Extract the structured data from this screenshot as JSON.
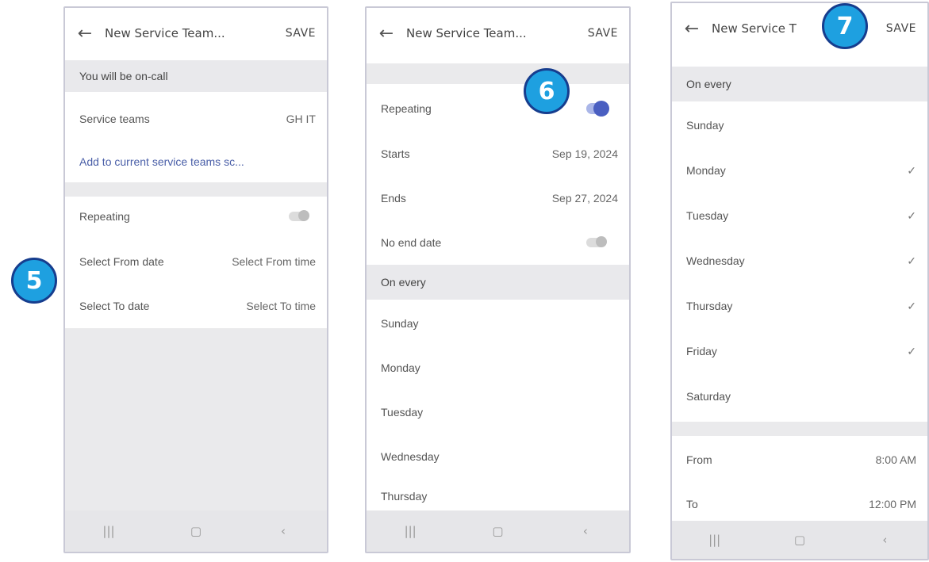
{
  "badges": [
    "5",
    "6",
    "7"
  ],
  "screen1": {
    "header": {
      "back": "←",
      "title": "New Service Team...",
      "save": "SAVE"
    },
    "on_call_section": "You will be on-call",
    "service_teams_label": "Service teams",
    "service_teams_value": "GH IT",
    "add_link": "Add to current service teams sc...",
    "repeating_label": "Repeating",
    "from_date_label": "Select From date",
    "from_time_label": "Select From time",
    "to_date_label": "Select To date",
    "to_time_label": "Select To time"
  },
  "screen2": {
    "header": {
      "back": "←",
      "title": "New Service Team...",
      "save": "SAVE"
    },
    "repeating_label": "Repeating",
    "starts_label": "Starts",
    "starts_value": "Sep 19, 2024",
    "ends_label": "Ends",
    "ends_value": "Sep 27, 2024",
    "no_end_label": "No end date",
    "on_every_section": "On every",
    "days": [
      "Sunday",
      "Monday",
      "Tuesday",
      "Wednesday",
      "Thursday"
    ]
  },
  "screen3": {
    "header": {
      "back": "←",
      "title": "New Service T",
      "save": "SAVE"
    },
    "on_every_section": "On every",
    "days": [
      {
        "label": "Sunday",
        "check": ""
      },
      {
        "label": "Monday",
        "check": "✓"
      },
      {
        "label": "Tuesday",
        "check": "✓"
      },
      {
        "label": "Wednesday",
        "check": "✓"
      },
      {
        "label": "Thursday",
        "check": "✓"
      },
      {
        "label": "Friday",
        "check": "✓"
      },
      {
        "label": "Saturday",
        "check": ""
      }
    ],
    "from_label": "From",
    "from_value": "8:00 AM",
    "to_label": "To",
    "to_value": "12:00 PM"
  },
  "navbar": {
    "recents": "|||",
    "home": "▢",
    "back": "‹"
  },
  "colors": {
    "badge_fill": "#1ea0e0",
    "badge_border": "#163d8e",
    "toggle_on": "#4a5fc1",
    "link": "#4a5fa8"
  }
}
